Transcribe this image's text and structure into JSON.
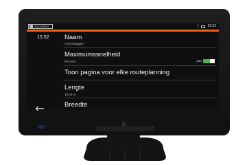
{
  "statusbar": {
    "brand": "SNOOPER",
    "bluetooth_icon": "bluetooth-icon",
    "battery_icon": "battery-icon",
    "time": "15:52"
  },
  "side_panel": {
    "time": "15:52",
    "back_icon": "arrow-left-icon"
  },
  "colors": {
    "accent": "#f0611e",
    "toggle_on": "#4caf50",
    "screen_bg": "#0f0f0f"
  },
  "settings": {
    "naam": {
      "title": "Naam",
      "value": "Vrachtwaggen"
    },
    "max_speed": {
      "title": "Maximumssnelheid",
      "value": "90 km/h",
      "toggle_label": "aan",
      "toggle_on": true
    },
    "show_page": {
      "title": "Toon pagina voor elke routeplanning"
    },
    "lengte": {
      "title": "Lengte",
      "value": "18.00 m"
    },
    "breedte": {
      "title": "Breedte"
    }
  }
}
